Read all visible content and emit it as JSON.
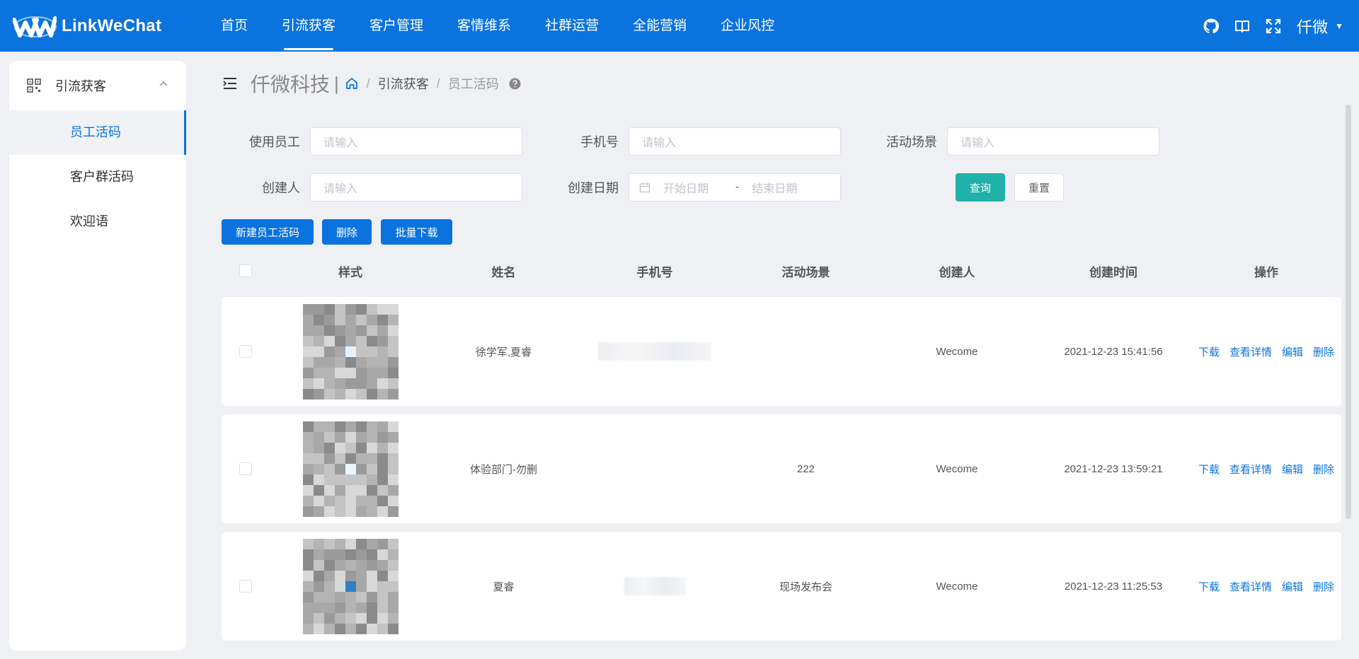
{
  "brand": {
    "name": "LinkWeChat"
  },
  "nav": {
    "items": [
      {
        "label": "首页",
        "active": false
      },
      {
        "label": "引流获客",
        "active": true
      },
      {
        "label": "客户管理",
        "active": false
      },
      {
        "label": "客情维系",
        "active": false
      },
      {
        "label": "社群运营",
        "active": false
      },
      {
        "label": "全能营销",
        "active": false
      },
      {
        "label": "企业风控",
        "active": false
      }
    ]
  },
  "header": {
    "icons": [
      "github-icon",
      "book-icon",
      "fullscreen-icon"
    ],
    "user": "仟微"
  },
  "sidebar": {
    "group": {
      "label": "引流获客",
      "icon": "qrcode-icon"
    },
    "items": [
      {
        "label": "员工活码",
        "active": true
      },
      {
        "label": "客户群活码",
        "active": false
      },
      {
        "label": "欢迎语",
        "active": false
      }
    ]
  },
  "breadcrumb": {
    "company": "仟微科技",
    "items": [
      "引流获客",
      "员工活码"
    ]
  },
  "filters": {
    "employee": {
      "label": "使用员工",
      "placeholder": "请输入"
    },
    "phone": {
      "label": "手机号",
      "placeholder": "请输入"
    },
    "scene": {
      "label": "活动场景",
      "placeholder": "请输入"
    },
    "creator": {
      "label": "创建人",
      "placeholder": "请输入"
    },
    "date": {
      "label": "创建日期",
      "start_placeholder": "开始日期",
      "end_placeholder": "结束日期",
      "separator": "-"
    },
    "search_label": "查询",
    "reset_label": "重置"
  },
  "actions": {
    "new_label": "新建员工活码",
    "delete_label": "删除",
    "batch_download_label": "批量下载"
  },
  "table": {
    "columns": [
      "样式",
      "姓名",
      "手机号",
      "活动场景",
      "创建人",
      "创建时间",
      "操作"
    ],
    "rows": [
      {
        "name": "徐学军,夏睿",
        "scene": "",
        "creator": "Wecome",
        "time": "2021-12-23 15:41:56",
        "phone_blur_width": 0.72
      },
      {
        "name": "体验部门-勿删",
        "scene": "222",
        "creator": "Wecome",
        "time": "2021-12-23 13:59:21",
        "phone_blur_width": 0
      },
      {
        "name": "夏睿",
        "scene": "现场发布会",
        "creator": "Wecome",
        "time": "2021-12-23 11:25:53",
        "phone_blur_width": 0.39
      }
    ],
    "row_actions": [
      "下载",
      "查看详情",
      "编辑",
      "删除"
    ]
  },
  "colors": {
    "primary": "#0a73de",
    "teal": "#20b2aa"
  }
}
